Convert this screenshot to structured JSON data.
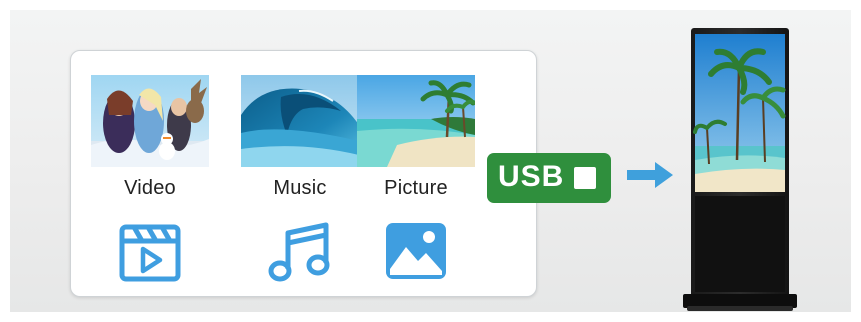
{
  "media": [
    {
      "label": "Video",
      "icon": "video-clapperboard-icon"
    },
    {
      "label": "Music",
      "icon": "music-note-icon"
    },
    {
      "label": "Picture",
      "icon": "picture-icon"
    }
  ],
  "usb": {
    "label": "USB"
  },
  "colors": {
    "icon_blue": "#3f9ee0",
    "usb_green": "#2f8f3d",
    "arrow_blue": "#3fa0dc"
  }
}
